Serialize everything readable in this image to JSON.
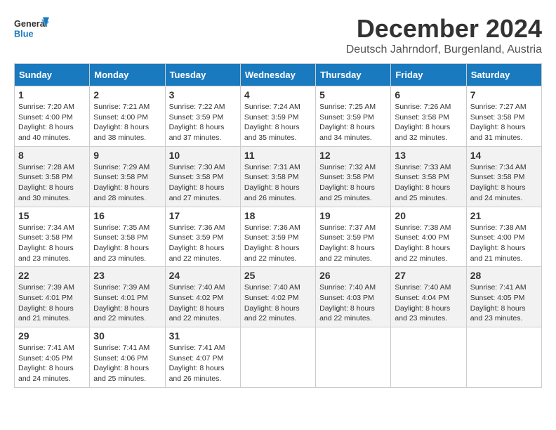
{
  "header": {
    "logo_general": "General",
    "logo_blue": "Blue",
    "main_title": "December 2024",
    "subtitle": "Deutsch Jahrndorf, Burgenland, Austria"
  },
  "calendar": {
    "days_of_week": [
      "Sunday",
      "Monday",
      "Tuesday",
      "Wednesday",
      "Thursday",
      "Friday",
      "Saturday"
    ],
    "weeks": [
      [
        null,
        {
          "day": "2",
          "sunrise": "7:21 AM",
          "sunset": "4:00 PM",
          "daylight": "8 hours and 38 minutes."
        },
        {
          "day": "3",
          "sunrise": "7:22 AM",
          "sunset": "3:59 PM",
          "daylight": "8 hours and 37 minutes."
        },
        {
          "day": "4",
          "sunrise": "7:24 AM",
          "sunset": "3:59 PM",
          "daylight": "8 hours and 35 minutes."
        },
        {
          "day": "5",
          "sunrise": "7:25 AM",
          "sunset": "3:59 PM",
          "daylight": "8 hours and 34 minutes."
        },
        {
          "day": "6",
          "sunrise": "7:26 AM",
          "sunset": "3:58 PM",
          "daylight": "8 hours and 32 minutes."
        },
        {
          "day": "7",
          "sunrise": "7:27 AM",
          "sunset": "3:58 PM",
          "daylight": "8 hours and 31 minutes."
        }
      ],
      [
        {
          "day": "1",
          "sunrise": "7:20 AM",
          "sunset": "4:00 PM",
          "daylight": "8 hours and 40 minutes."
        },
        {
          "day": "9",
          "sunrise": "7:29 AM",
          "sunset": "3:58 PM",
          "daylight": "8 hours and 28 minutes."
        },
        {
          "day": "10",
          "sunrise": "7:30 AM",
          "sunset": "3:58 PM",
          "daylight": "8 hours and 27 minutes."
        },
        {
          "day": "11",
          "sunrise": "7:31 AM",
          "sunset": "3:58 PM",
          "daylight": "8 hours and 26 minutes."
        },
        {
          "day": "12",
          "sunrise": "7:32 AM",
          "sunset": "3:58 PM",
          "daylight": "8 hours and 25 minutes."
        },
        {
          "day": "13",
          "sunrise": "7:33 AM",
          "sunset": "3:58 PM",
          "daylight": "8 hours and 25 minutes."
        },
        {
          "day": "14",
          "sunrise": "7:34 AM",
          "sunset": "3:58 PM",
          "daylight": "8 hours and 24 minutes."
        }
      ],
      [
        {
          "day": "8",
          "sunrise": "7:28 AM",
          "sunset": "3:58 PM",
          "daylight": "8 hours and 30 minutes."
        },
        {
          "day": "16",
          "sunrise": "7:35 AM",
          "sunset": "3:58 PM",
          "daylight": "8 hours and 23 minutes."
        },
        {
          "day": "17",
          "sunrise": "7:36 AM",
          "sunset": "3:59 PM",
          "daylight": "8 hours and 22 minutes."
        },
        {
          "day": "18",
          "sunrise": "7:36 AM",
          "sunset": "3:59 PM",
          "daylight": "8 hours and 22 minutes."
        },
        {
          "day": "19",
          "sunrise": "7:37 AM",
          "sunset": "3:59 PM",
          "daylight": "8 hours and 22 minutes."
        },
        {
          "day": "20",
          "sunrise": "7:38 AM",
          "sunset": "4:00 PM",
          "daylight": "8 hours and 22 minutes."
        },
        {
          "day": "21",
          "sunrise": "7:38 AM",
          "sunset": "4:00 PM",
          "daylight": "8 hours and 21 minutes."
        }
      ],
      [
        {
          "day": "15",
          "sunrise": "7:34 AM",
          "sunset": "3:58 PM",
          "daylight": "8 hours and 23 minutes."
        },
        {
          "day": "23",
          "sunrise": "7:39 AM",
          "sunset": "4:01 PM",
          "daylight": "8 hours and 22 minutes."
        },
        {
          "day": "24",
          "sunrise": "7:40 AM",
          "sunset": "4:02 PM",
          "daylight": "8 hours and 22 minutes."
        },
        {
          "day": "25",
          "sunrise": "7:40 AM",
          "sunset": "4:02 PM",
          "daylight": "8 hours and 22 minutes."
        },
        {
          "day": "26",
          "sunrise": "7:40 AM",
          "sunset": "4:03 PM",
          "daylight": "8 hours and 22 minutes."
        },
        {
          "day": "27",
          "sunrise": "7:40 AM",
          "sunset": "4:04 PM",
          "daylight": "8 hours and 23 minutes."
        },
        {
          "day": "28",
          "sunrise": "7:41 AM",
          "sunset": "4:05 PM",
          "daylight": "8 hours and 23 minutes."
        }
      ],
      [
        {
          "day": "22",
          "sunrise": "7:39 AM",
          "sunset": "4:01 PM",
          "daylight": "8 hours and 21 minutes."
        },
        {
          "day": "30",
          "sunrise": "7:41 AM",
          "sunset": "4:06 PM",
          "daylight": "8 hours and 25 minutes."
        },
        {
          "day": "31",
          "sunrise": "7:41 AM",
          "sunset": "4:07 PM",
          "daylight": "8 hours and 26 minutes."
        },
        null,
        null,
        null,
        null
      ],
      [
        {
          "day": "29",
          "sunrise": "7:41 AM",
          "sunset": "4:05 PM",
          "daylight": "8 hours and 24 minutes."
        },
        null,
        null,
        null,
        null,
        null,
        null
      ]
    ],
    "week_order": [
      [
        {
          "day": "1",
          "sunrise": "7:20 AM",
          "sunset": "4:00 PM",
          "daylight": "8 hours and 40 minutes."
        },
        {
          "day": "2",
          "sunrise": "7:21 AM",
          "sunset": "4:00 PM",
          "daylight": "8 hours and 38 minutes."
        },
        {
          "day": "3",
          "sunrise": "7:22 AM",
          "sunset": "3:59 PM",
          "daylight": "8 hours and 37 minutes."
        },
        {
          "day": "4",
          "sunrise": "7:24 AM",
          "sunset": "3:59 PM",
          "daylight": "8 hours and 35 minutes."
        },
        {
          "day": "5",
          "sunrise": "7:25 AM",
          "sunset": "3:59 PM",
          "daylight": "8 hours and 34 minutes."
        },
        {
          "day": "6",
          "sunrise": "7:26 AM",
          "sunset": "3:58 PM",
          "daylight": "8 hours and 32 minutes."
        },
        {
          "day": "7",
          "sunrise": "7:27 AM",
          "sunset": "3:58 PM",
          "daylight": "8 hours and 31 minutes."
        }
      ],
      [
        {
          "day": "8",
          "sunrise": "7:28 AM",
          "sunset": "3:58 PM",
          "daylight": "8 hours and 30 minutes."
        },
        {
          "day": "9",
          "sunrise": "7:29 AM",
          "sunset": "3:58 PM",
          "daylight": "8 hours and 28 minutes."
        },
        {
          "day": "10",
          "sunrise": "7:30 AM",
          "sunset": "3:58 PM",
          "daylight": "8 hours and 27 minutes."
        },
        {
          "day": "11",
          "sunrise": "7:31 AM",
          "sunset": "3:58 PM",
          "daylight": "8 hours and 26 minutes."
        },
        {
          "day": "12",
          "sunrise": "7:32 AM",
          "sunset": "3:58 PM",
          "daylight": "8 hours and 25 minutes."
        },
        {
          "day": "13",
          "sunrise": "7:33 AM",
          "sunset": "3:58 PM",
          "daylight": "8 hours and 25 minutes."
        },
        {
          "day": "14",
          "sunrise": "7:34 AM",
          "sunset": "3:58 PM",
          "daylight": "8 hours and 24 minutes."
        }
      ],
      [
        {
          "day": "15",
          "sunrise": "7:34 AM",
          "sunset": "3:58 PM",
          "daylight": "8 hours and 23 minutes."
        },
        {
          "day": "16",
          "sunrise": "7:35 AM",
          "sunset": "3:58 PM",
          "daylight": "8 hours and 23 minutes."
        },
        {
          "day": "17",
          "sunrise": "7:36 AM",
          "sunset": "3:59 PM",
          "daylight": "8 hours and 22 minutes."
        },
        {
          "day": "18",
          "sunrise": "7:36 AM",
          "sunset": "3:59 PM",
          "daylight": "8 hours and 22 minutes."
        },
        {
          "day": "19",
          "sunrise": "7:37 AM",
          "sunset": "3:59 PM",
          "daylight": "8 hours and 22 minutes."
        },
        {
          "day": "20",
          "sunrise": "7:38 AM",
          "sunset": "4:00 PM",
          "daylight": "8 hours and 22 minutes."
        },
        {
          "day": "21",
          "sunrise": "7:38 AM",
          "sunset": "4:00 PM",
          "daylight": "8 hours and 21 minutes."
        }
      ],
      [
        {
          "day": "22",
          "sunrise": "7:39 AM",
          "sunset": "4:01 PM",
          "daylight": "8 hours and 21 minutes."
        },
        {
          "day": "23",
          "sunrise": "7:39 AM",
          "sunset": "4:01 PM",
          "daylight": "8 hours and 22 minutes."
        },
        {
          "day": "24",
          "sunrise": "7:40 AM",
          "sunset": "4:02 PM",
          "daylight": "8 hours and 22 minutes."
        },
        {
          "day": "25",
          "sunrise": "7:40 AM",
          "sunset": "4:02 PM",
          "daylight": "8 hours and 22 minutes."
        },
        {
          "day": "26",
          "sunrise": "7:40 AM",
          "sunset": "4:03 PM",
          "daylight": "8 hours and 22 minutes."
        },
        {
          "day": "27",
          "sunrise": "7:40 AM",
          "sunset": "4:04 PM",
          "daylight": "8 hours and 23 minutes."
        },
        {
          "day": "28",
          "sunrise": "7:41 AM",
          "sunset": "4:05 PM",
          "daylight": "8 hours and 23 minutes."
        }
      ],
      [
        {
          "day": "29",
          "sunrise": "7:41 AM",
          "sunset": "4:05 PM",
          "daylight": "8 hours and 24 minutes."
        },
        {
          "day": "30",
          "sunrise": "7:41 AM",
          "sunset": "4:06 PM",
          "daylight": "8 hours and 25 minutes."
        },
        {
          "day": "31",
          "sunrise": "7:41 AM",
          "sunset": "4:07 PM",
          "daylight": "8 hours and 26 minutes."
        },
        null,
        null,
        null,
        null
      ]
    ]
  }
}
